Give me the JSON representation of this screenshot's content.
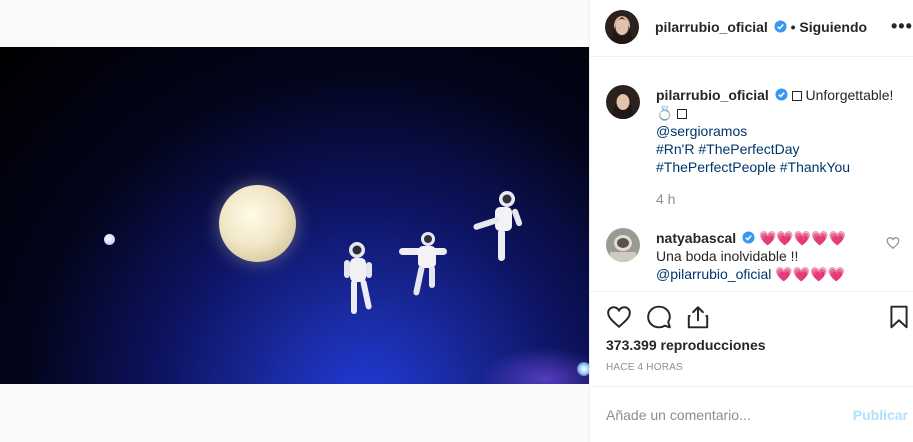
{
  "post": {
    "author": "pilarrubio_oficial",
    "separator": "•",
    "follow_status": "Siguiendo",
    "more_label": "•••",
    "caption": {
      "username": "pilarrubio_oficial",
      "text_line1": "Unforgettable!",
      "ring_emoji": "💍",
      "mention": "@sergioramos",
      "hashtags_line1": "#Rn'R #ThePerfectDay",
      "hashtags_line2": "#ThePerfectPeople #ThankYou"
    },
    "time_ago": "4 h",
    "comment": {
      "username": "natyabascal",
      "hearts1": "💗💗💗💗💗",
      "text": "Una boda inolvidable !!",
      "mention": "@pilarrubio_oficial",
      "hearts2": "💗💗💗💗"
    },
    "views": "373.399 reproducciones",
    "posted_ago": "HACE 4 HORAS",
    "comment_placeholder": "Añade un comentario...",
    "publish_label": "Publicar"
  },
  "colors": {
    "accent_link": "#00376b",
    "verified": "#3897f0",
    "muted": "#8e8e8e",
    "publish_disabled": "#b2dffc"
  },
  "icons": [
    "user-tag-icon",
    "verified-badge-icon",
    "more-icon",
    "heart-icon",
    "comment-icon",
    "share-icon",
    "bookmark-icon"
  ]
}
